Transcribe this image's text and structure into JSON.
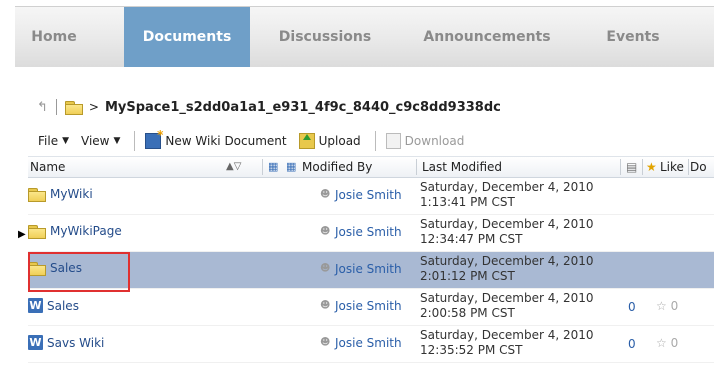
{
  "tabs": [
    {
      "label": "Home",
      "active": false
    },
    {
      "label": "Documents",
      "active": true
    },
    {
      "label": "Discussions",
      "active": false
    },
    {
      "label": "Announcements",
      "active": false
    },
    {
      "label": "Events",
      "active": false
    }
  ],
  "path": {
    "prefix": ">",
    "text": "MySpace1_s2dd0a1a1_e931_4f9c_8440_c9c8dd9338dc"
  },
  "toolbar": {
    "file": "File",
    "view": "View",
    "new_wiki": "New Wiki Document",
    "upload": "Upload",
    "download": "Download"
  },
  "columns": {
    "name": "Name",
    "modified_by": "Modified By",
    "last_modified": "Last Modified",
    "like": "Like",
    "extra": "Do"
  },
  "rows": [
    {
      "icon": "folder",
      "name": "MyWiki",
      "by": "Josie Smith",
      "mod1": "Saturday, December 4, 2010",
      "mod2": "1:13:41 PM CST",
      "count": "",
      "likes": ""
    },
    {
      "icon": "folder",
      "name": "MyWikiPage",
      "by": "Josie Smith",
      "mod1": "Saturday, December 4, 2010",
      "mod2": "12:34:47 PM CST",
      "count": "",
      "likes": ""
    },
    {
      "icon": "folder",
      "name": "Sales",
      "by": "Josie Smith",
      "mod1": "Saturday, December 4, 2010",
      "mod2": "2:01:12 PM CST",
      "count": "",
      "likes": "",
      "selected": true
    },
    {
      "icon": "wiki",
      "name": "Sales",
      "by": "Josie Smith",
      "mod1": "Saturday, December 4, 2010",
      "mod2": "2:00:58 PM CST",
      "count": "0",
      "likes": "0"
    },
    {
      "icon": "wiki",
      "name": "Savs Wiki",
      "by": "Josie Smith",
      "mod1": "Saturday, December 4, 2010",
      "mod2": "12:35:52 PM CST",
      "count": "0",
      "likes": "0"
    }
  ],
  "wiki_letter": "W",
  "colors": {
    "active_tab": "#6f9fc8",
    "selected_row": "#a9b9d3",
    "highlight": "#e03030",
    "link": "#2a5ea8"
  }
}
